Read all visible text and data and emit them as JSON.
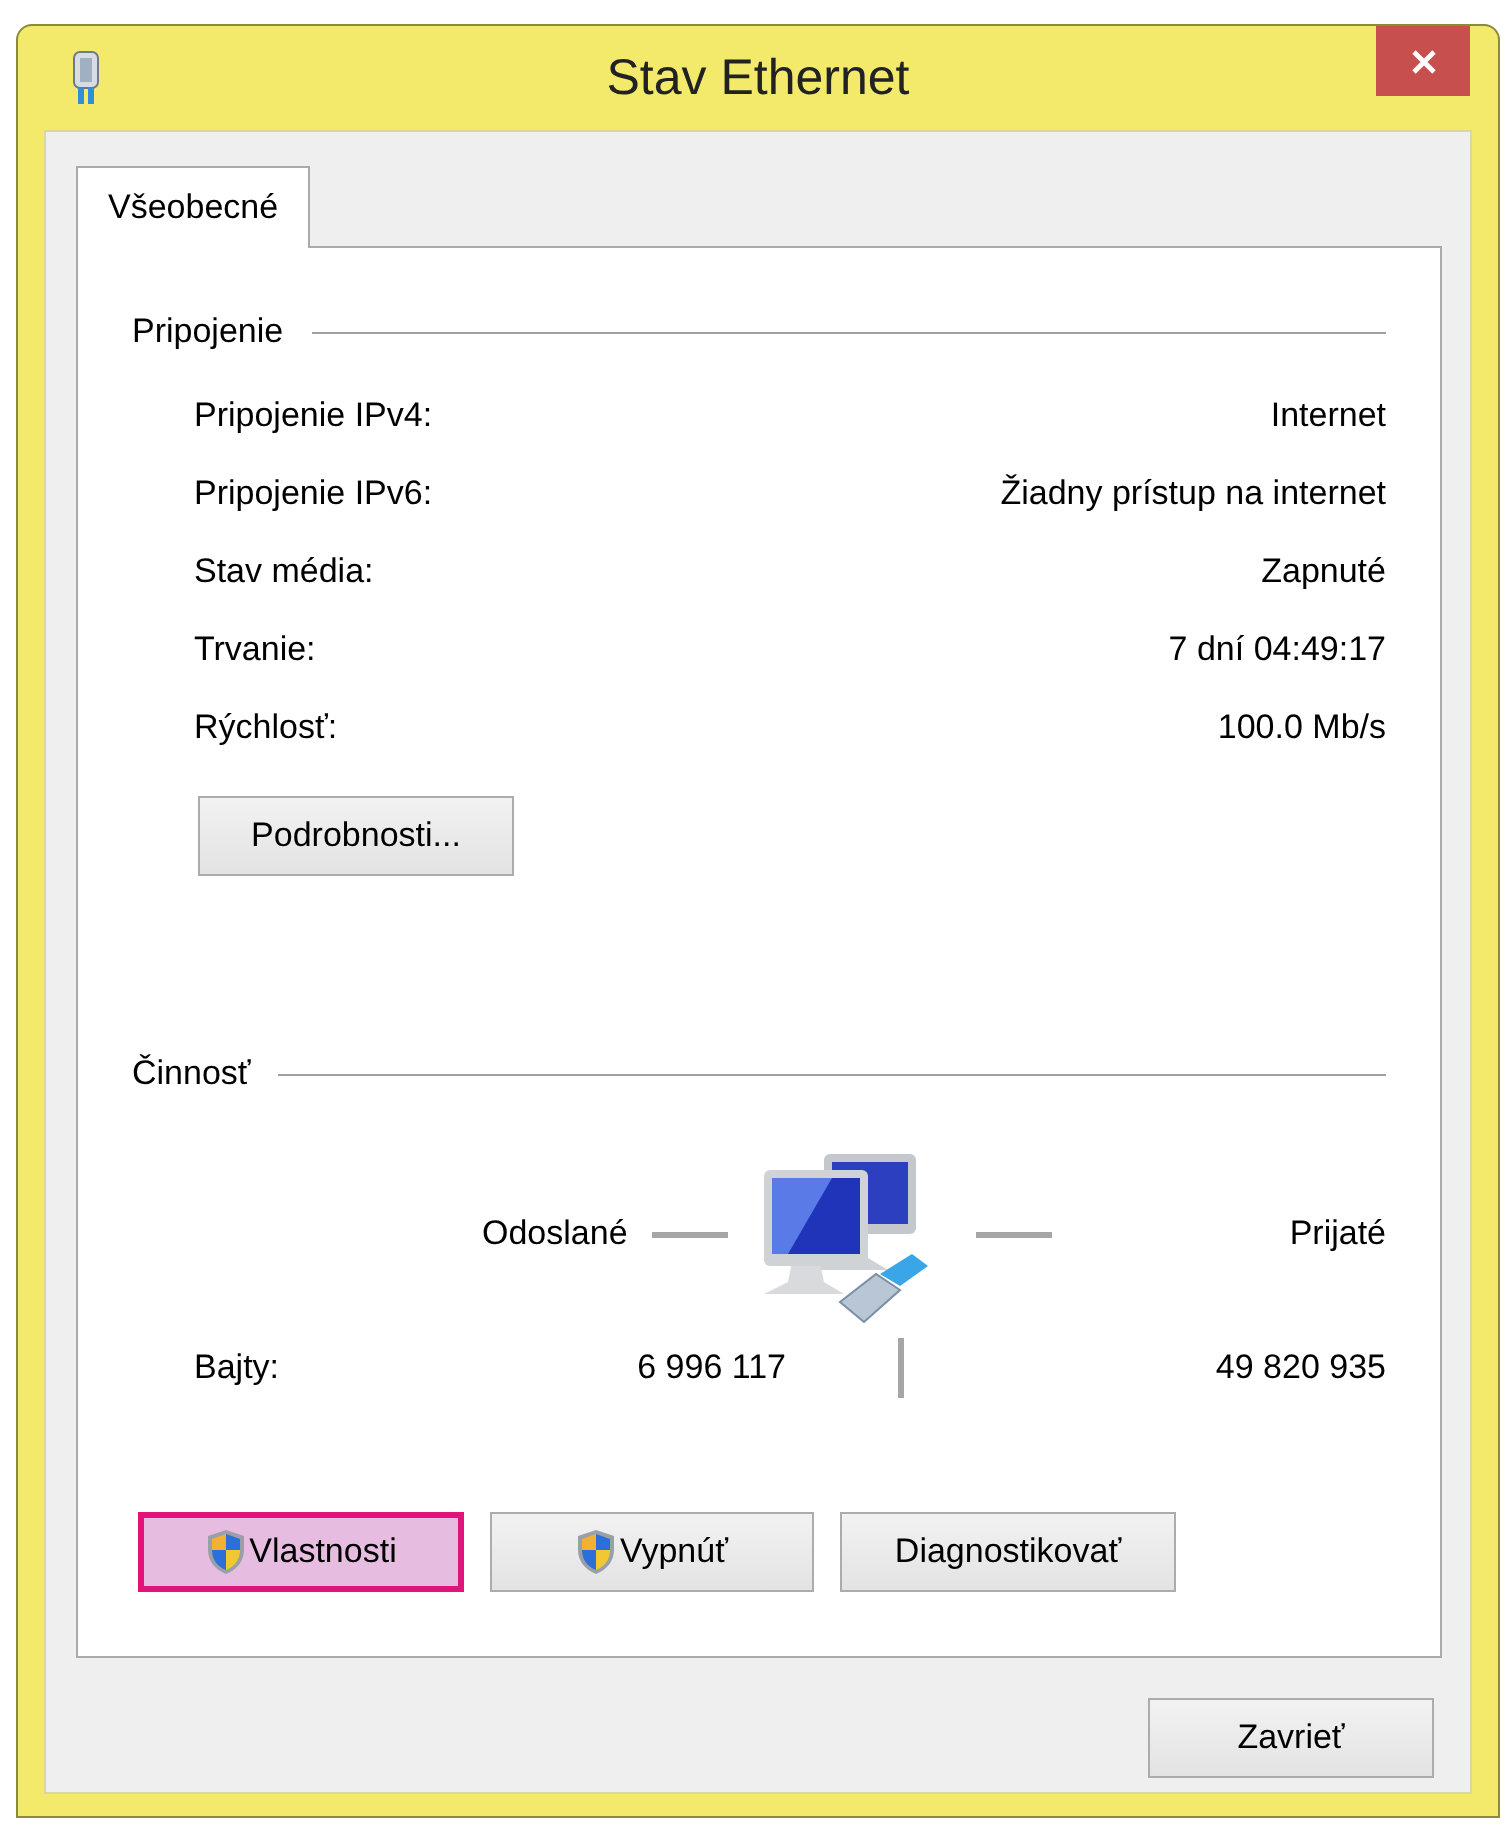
{
  "window": {
    "title": "Stav Ethernet"
  },
  "tabs": [
    {
      "label": "Všeobecné",
      "selected": true
    }
  ],
  "connection": {
    "heading": "Pripojenie",
    "rows": [
      {
        "label": "Pripojenie IPv4:",
        "value": "Internet"
      },
      {
        "label": "Pripojenie IPv6:",
        "value": "Žiadny prístup na internet"
      },
      {
        "label": "Stav média:",
        "value": "Zapnuté"
      },
      {
        "label": "Trvanie:",
        "value": "7 dní 04:49:17"
      },
      {
        "label": "Rýchlosť:",
        "value": "100.0 Mb/s"
      }
    ],
    "details_button": "Podrobnosti..."
  },
  "activity": {
    "heading": "Činnosť",
    "sent_label": "Odoslané",
    "received_label": "Prijaté",
    "bytes_label": "Bajty:",
    "sent": "6 996 117",
    "received": "49 820 935"
  },
  "buttons": [
    {
      "label": "Vlastnosti",
      "kind": "shield",
      "highlighted": true
    },
    {
      "label": "Vypnúť",
      "kind": "shield",
      "highlighted": false
    },
    {
      "label": "Diagnostikovať",
      "kind": "plain",
      "highlighted": false
    }
  ],
  "close_button": "Zavrieť"
}
